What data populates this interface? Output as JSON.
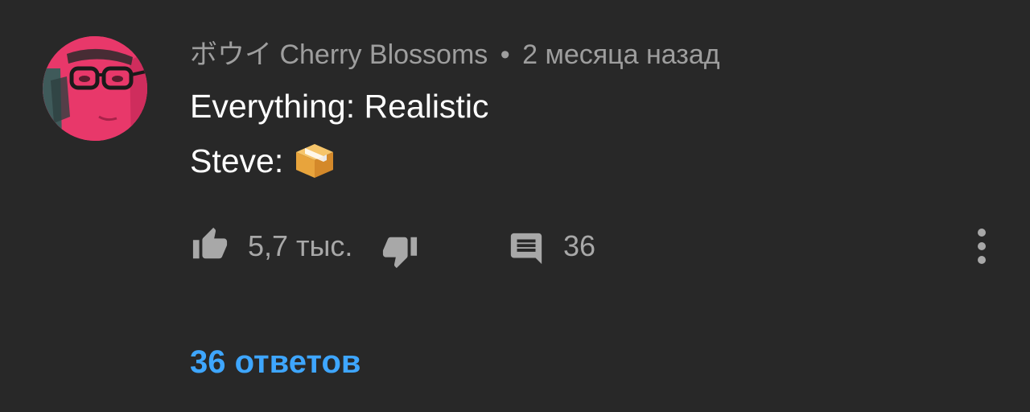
{
  "comment": {
    "author": "ボウイ Cherry Blossoms",
    "separator": "•",
    "time": "2 месяца назад",
    "lines": [
      "Everything: Realistic",
      "Steve:"
    ],
    "emoji_icon": "package-box-icon",
    "like_count": "5,7 тыс.",
    "reply_count": "36",
    "replies_link": "36 ответов"
  },
  "icons": {
    "like": "thumbs-up-icon",
    "dislike": "thumbs-down-icon",
    "reply": "comment-icon",
    "more": "more-vertical-icon"
  },
  "colors": {
    "background": "#282828",
    "meta_text": "#9e9e9e",
    "body_text": "#ffffff",
    "icon": "#a8a8a8",
    "link": "#3ea6ff",
    "avatar_bg": "#e8386a"
  }
}
